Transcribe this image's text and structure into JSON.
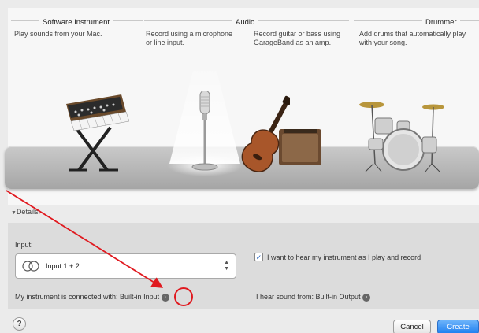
{
  "columns": {
    "software_instrument": {
      "title": "Software Instrument",
      "desc_1": "Play sounds from your Mac."
    },
    "audio": {
      "title": "Audio",
      "microphone": {
        "line_1": "Record using a microphone",
        "line_2": "or line input."
      },
      "guitar": {
        "line_1": "Record guitar or bass using",
        "line_2": "GarageBand as an amp."
      }
    },
    "drummer": {
      "title": "Drummer",
      "line_1": "Add drums that automatically play",
      "line_2": "with your song."
    }
  },
  "details": {
    "label": "Details:",
    "arrow": "▼"
  },
  "input": {
    "label": "Input:",
    "value": "Input 1 + 2",
    "icon": "stereo-rings-icon"
  },
  "monitoring": {
    "checked": true,
    "label": "I want to hear my instrument as I play and record"
  },
  "connected": {
    "label": "My instrument is connected with: Built-in Input"
  },
  "output": {
    "label": "I hear sound from: Built-in Output"
  },
  "buttons": {
    "help": "?",
    "cancel": "Cancel",
    "create": "Create"
  },
  "annotation": {
    "color": "#e0191f"
  }
}
